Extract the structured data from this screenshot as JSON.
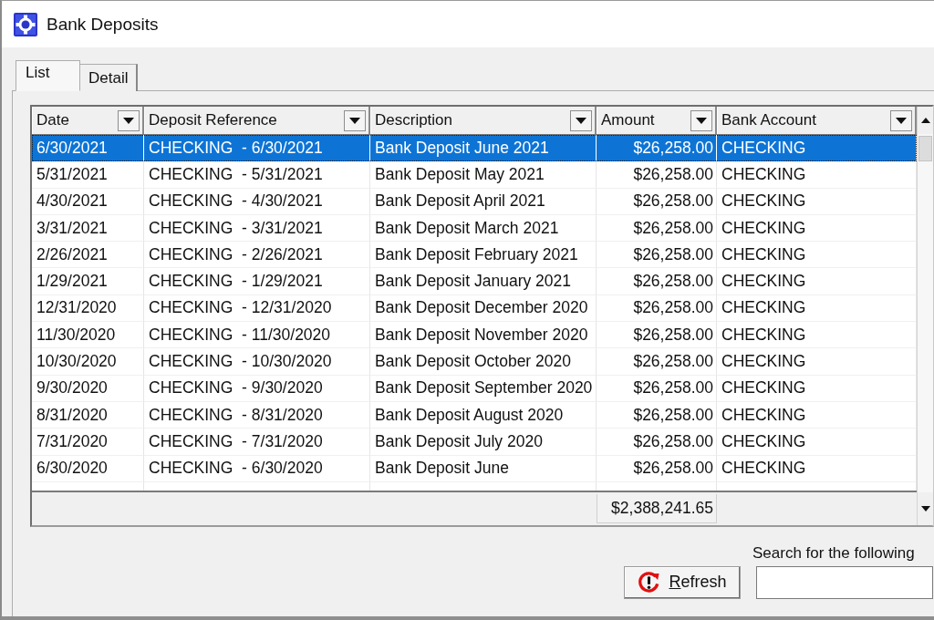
{
  "window": {
    "title": "Bank Deposits"
  },
  "tabs": [
    {
      "label": "List",
      "selected": true
    },
    {
      "label": "Detail",
      "selected": false
    }
  ],
  "table": {
    "columns": [
      {
        "label": "Date",
        "kind": "text"
      },
      {
        "label": "Deposit Reference",
        "kind": "text"
      },
      {
        "label": "Description",
        "kind": "text"
      },
      {
        "label": "Amount",
        "kind": "amount"
      },
      {
        "label": "Bank Account",
        "kind": "text"
      }
    ],
    "rows": [
      {
        "selected": true,
        "cells": [
          "6/30/2021",
          "CHECKING  - 6/30/2021",
          "Bank Deposit June 2021",
          "$26,258.00",
          "CHECKING"
        ]
      },
      {
        "selected": false,
        "cells": [
          "5/31/2021",
          "CHECKING  - 5/31/2021",
          "Bank Deposit May 2021",
          "$26,258.00",
          "CHECKING"
        ]
      },
      {
        "selected": false,
        "cells": [
          "4/30/2021",
          "CHECKING  - 4/30/2021",
          "Bank Deposit April 2021",
          "$26,258.00",
          "CHECKING"
        ]
      },
      {
        "selected": false,
        "cells": [
          "3/31/2021",
          "CHECKING  - 3/31/2021",
          "Bank Deposit March 2021",
          "$26,258.00",
          "CHECKING"
        ]
      },
      {
        "selected": false,
        "cells": [
          "2/26/2021",
          "CHECKING  - 2/26/2021",
          "Bank Deposit February 2021",
          "$26,258.00",
          "CHECKING"
        ]
      },
      {
        "selected": false,
        "cells": [
          "1/29/2021",
          "CHECKING  - 1/29/2021",
          "Bank Deposit January 2021",
          "$26,258.00",
          "CHECKING"
        ]
      },
      {
        "selected": false,
        "cells": [
          "12/31/2020",
          "CHECKING  - 12/31/2020",
          "Bank Deposit December 2020",
          "$26,258.00",
          "CHECKING"
        ]
      },
      {
        "selected": false,
        "cells": [
          "11/30/2020",
          "CHECKING  - 11/30/2020",
          "Bank Deposit November 2020",
          "$26,258.00",
          "CHECKING"
        ]
      },
      {
        "selected": false,
        "cells": [
          "10/30/2020",
          "CHECKING  - 10/30/2020",
          "Bank Deposit October 2020",
          "$26,258.00",
          "CHECKING"
        ]
      },
      {
        "selected": false,
        "cells": [
          "9/30/2020",
          "CHECKING  - 9/30/2020",
          "Bank Deposit September 2020",
          "$26,258.00",
          "CHECKING"
        ]
      },
      {
        "selected": false,
        "cells": [
          "8/31/2020",
          "CHECKING  - 8/31/2020",
          "Bank Deposit August 2020",
          "$26,258.00",
          "CHECKING"
        ]
      },
      {
        "selected": false,
        "cells": [
          "7/31/2020",
          "CHECKING  - 7/31/2020",
          "Bank Deposit July 2020",
          "$26,258.00",
          "CHECKING"
        ]
      },
      {
        "selected": false,
        "cells": [
          "6/30/2020",
          "CHECKING  - 6/30/2020",
          "Bank Deposit June",
          "$26,258.00",
          "CHECKING"
        ]
      }
    ],
    "total": "$2,388,241.65"
  },
  "refresh_button": {
    "label_parts": [
      {
        "text": "R",
        "underlined": true
      },
      {
        "text": "efresh",
        "underlined": false
      }
    ]
  },
  "search": {
    "label": "Search for the following"
  }
}
